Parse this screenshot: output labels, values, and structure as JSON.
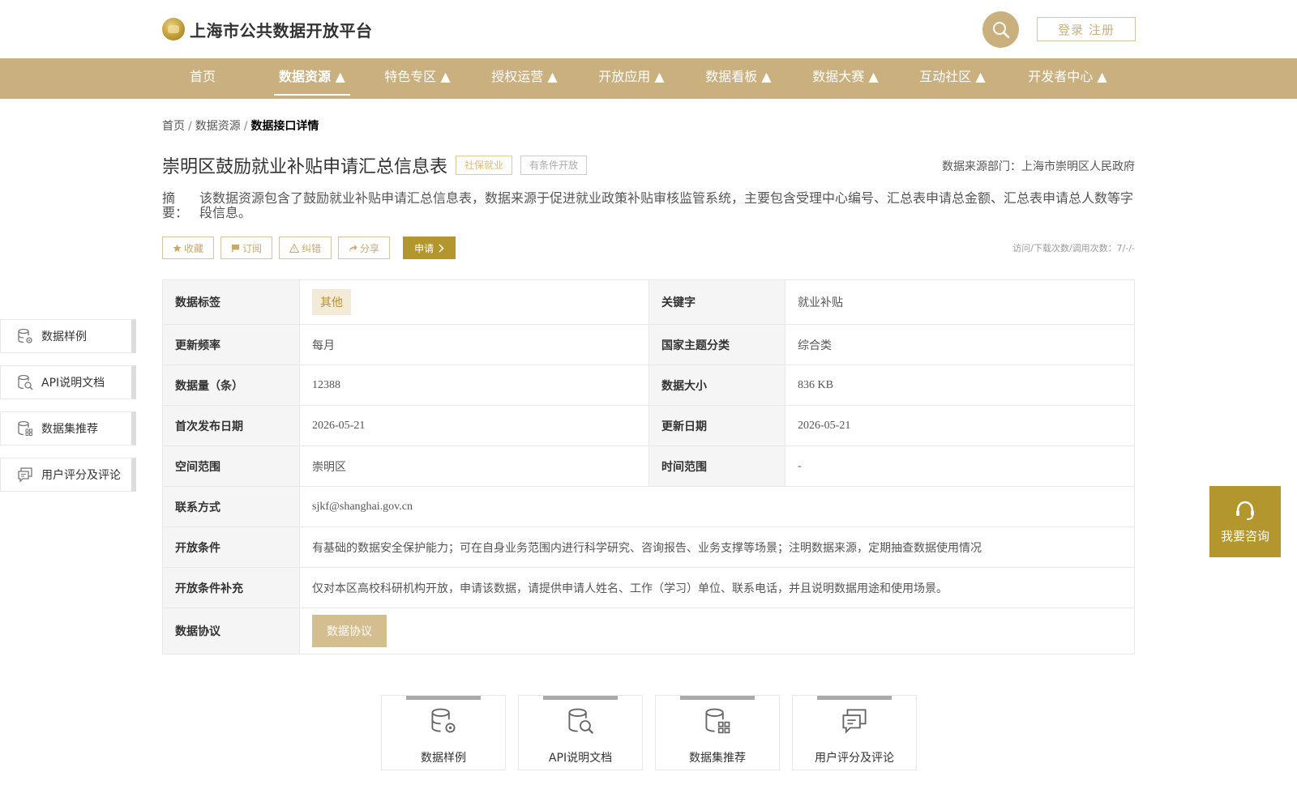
{
  "header": {
    "logo_text": "上海市公共数据开放平台",
    "login_label": "登录 注册"
  },
  "nav": {
    "items": [
      {
        "label": "首页"
      },
      {
        "label": "数据资源 ▲"
      },
      {
        "label": "特色专区 ▲"
      },
      {
        "label": "授权运营 ▲"
      },
      {
        "label": "开放应用 ▲"
      },
      {
        "label": "数据看板 ▲"
      },
      {
        "label": "数据大赛 ▲"
      },
      {
        "label": "互动社区 ▲"
      },
      {
        "label": "开发者中心 ▲"
      }
    ],
    "active_index": 1
  },
  "breadcrumb": {
    "items": [
      "首页",
      "数据资源",
      "数据接口详情"
    ],
    "separator": "/"
  },
  "detail": {
    "title": "崇明区鼓励就业补贴申请汇总信息表",
    "tags": [
      "社保就业",
      "有条件开放"
    ],
    "source": "数据来源部门：上海市崇明区人民政府",
    "summary_label": "摘要：",
    "summary_text": "该数据资源包含了鼓励就业补贴申请汇总信息表，数据来源于促进就业政策补贴审核监管系统，主要包含受理中心编号、汇总表申请总金额、汇总表申请总人数等字段信息。"
  },
  "actions": {
    "favorite": "收藏",
    "subscribe": "订阅",
    "report": "纠错",
    "share": "分享",
    "apply": "申请",
    "stats": "访问/下载次数/调用次数：7/-/-"
  },
  "table": {
    "data_tag_label": "数据标签",
    "data_tag_value": "其他",
    "keyword_label": "关键字",
    "keyword_value": "就业补贴",
    "freq_label": "更新频率",
    "freq_value": "每月",
    "theme_label": "国家主题分类",
    "theme_value": "综合类",
    "count_label": "数据量（条）",
    "count_value": "12388",
    "size_label": "数据大小",
    "size_value": "836 KB",
    "first_label": "首次发布日期",
    "first_value": "2026-05-21",
    "update_label": "更新日期",
    "update_value": "2026-05-21",
    "space_label": "空间范围",
    "space_value": "崇明区",
    "time_label": "时间范围",
    "time_value": "-",
    "contact_label": "联系方式",
    "contact_value": "sjkf@shanghai.gov.cn",
    "cond_label": "开放条件",
    "cond_value": "有基础的数据安全保护能力；可在自身业务范围内进行科学研究、咨询报告、业务支撑等场景；注明数据来源，定期抽查数据使用情况",
    "cond_extra_label": "开放条件补充",
    "cond_extra_value": "仅对本区高校科研机构开放，申请该数据，请提供申请人姓名、工作（学习）单位、联系电话，并且说明数据用途和使用场景。",
    "protocol_label": "数据协议",
    "protocol_button": "数据协议"
  },
  "side_nav": {
    "items": [
      {
        "label": "数据样例",
        "icon": "database-gear-icon"
      },
      {
        "label": "API说明文档",
        "icon": "document-search-icon"
      },
      {
        "label": "数据集推荐",
        "icon": "database-grid-icon"
      },
      {
        "label": "用户评分及评论",
        "icon": "comment-icon"
      }
    ]
  },
  "bottom_cards": {
    "items": [
      {
        "label": "数据样例",
        "icon": "database-gear-icon"
      },
      {
        "label": "API说明文档",
        "icon": "document-search-icon"
      },
      {
        "label": "数据集推荐",
        "icon": "database-grid-icon"
      },
      {
        "label": "用户评分及评论",
        "icon": "comment-icon"
      }
    ]
  },
  "consult": {
    "label": "我要咨询"
  },
  "colors": {
    "brand": "#c9b07e",
    "accent_dark": "#b3962d"
  }
}
